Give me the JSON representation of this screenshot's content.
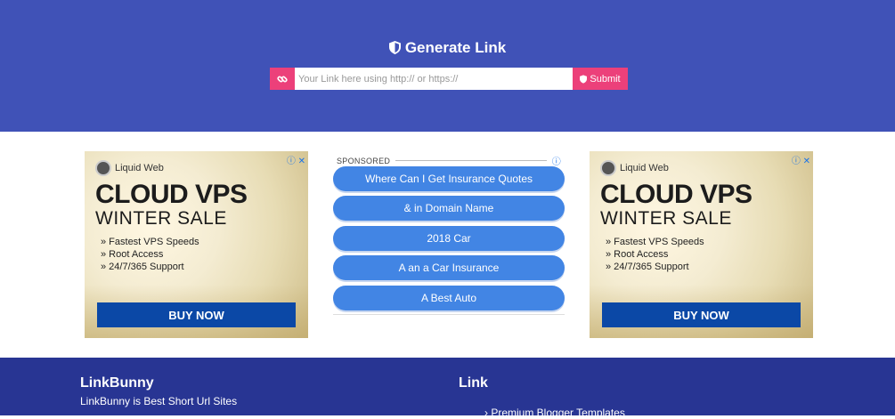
{
  "hero": {
    "title": "Generate Link",
    "input_placeholder": "Your Link here using http:// or https://",
    "submit_label": "Submit"
  },
  "ad_left": {
    "choices": "ⓘ ✕",
    "brand": "Liquid Web",
    "headline": "CLOUD VPS",
    "subheadline": "WINTER SALE",
    "bullets": [
      "» Fastest VPS Speeds",
      "» Root Access",
      "» 24/7/365 Support"
    ],
    "cta": "BUY NOW"
  },
  "ad_right": {
    "choices": "ⓘ ✕",
    "brand": "Liquid Web",
    "headline": "CLOUD VPS",
    "subheadline": "WINTER SALE",
    "bullets": [
      "» Fastest VPS Speeds",
      "» Root Access",
      "» 24/7/365 Support"
    ],
    "cta": "BUY NOW"
  },
  "sponsored": {
    "label": "SPONSORED",
    "info": "ⓘ",
    "links": [
      "Where Can I Get Insurance Quotes",
      "& in Domain Name",
      "2018 Car",
      "A an a Car Insurance",
      "A Best Auto"
    ]
  },
  "footer": {
    "brand": "LinkBunny",
    "description": "LinkBunny is Best Short Url Sites",
    "links_heading": "Link",
    "links": [
      "› Premium Blogger Templates"
    ]
  },
  "colors": {
    "hero_bg": "#4052b7",
    "accent_pink": "#ec407a",
    "sponsored_button": "#4285e4",
    "ad_cta": "#0b48a6",
    "footer_bg": "#283593"
  }
}
